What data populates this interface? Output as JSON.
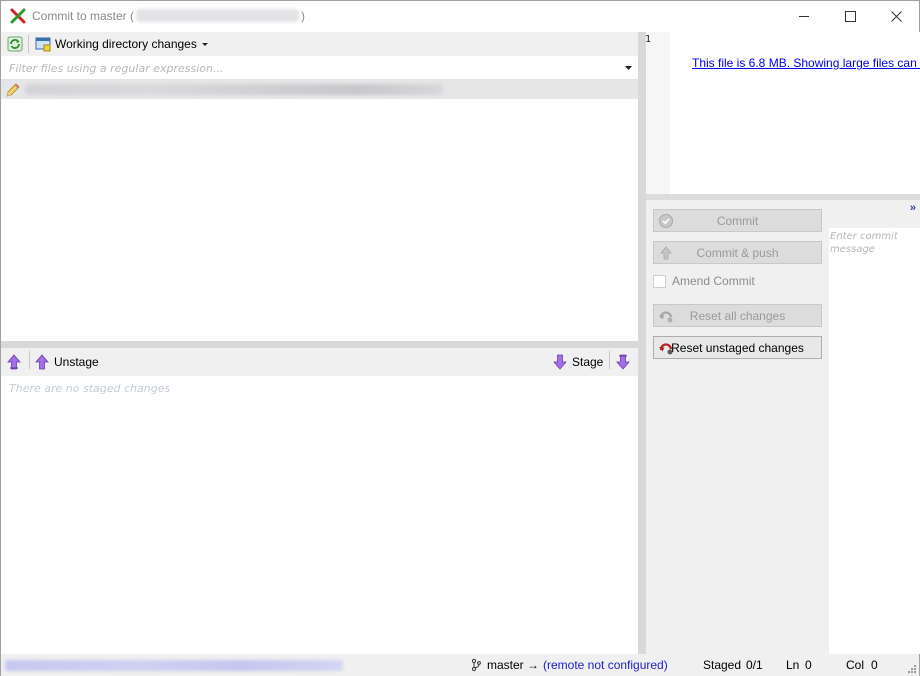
{
  "window": {
    "title": "Commit to master (",
    "title_close": ")"
  },
  "unstaged": {
    "changes_dropdown_label": "Working directory changes",
    "filter_placeholder": "Filter files using a regular expression..."
  },
  "staged": {
    "unstage_label": "Unstage",
    "stage_label": "Stage",
    "empty_text": "There are no staged changes"
  },
  "diff": {
    "line_number": "1",
    "large_file_message": "This file is 6.8 MB. Showing large files can b"
  },
  "commit_panel": {
    "commit_label": "Commit",
    "commit_push_label": "Commit & push",
    "amend_label": "Amend Commit",
    "reset_all_label": "Reset all changes",
    "reset_unstaged_label": "Reset unstaged changes",
    "message_placeholder": "Enter commit message",
    "expand_glyph": "»"
  },
  "statusbar": {
    "branch": "master →",
    "remote": "(remote not configured)",
    "staged_label": "Staged",
    "staged_value": "0/1",
    "ln_label": "Ln",
    "ln_value": "0",
    "col_label": "Col",
    "col_value": "0"
  },
  "colors": {
    "accent_link": "#0000ee",
    "remote_text": "#1c1cc8",
    "arrow_purple": "#9b4fd8",
    "app_icon_red": "#d02020",
    "app_icon_green": "#2a9a2a"
  }
}
